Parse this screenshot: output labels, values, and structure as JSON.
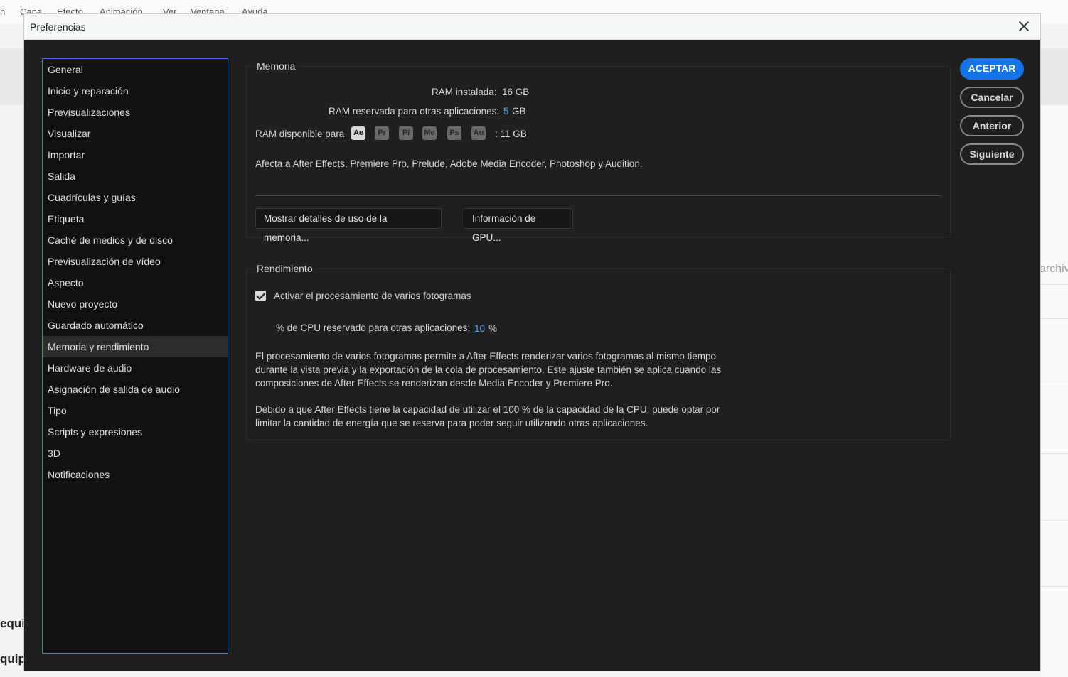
{
  "menubar": {
    "items": [
      "n",
      "Capa",
      "Efecto",
      "Animación",
      "Ver",
      "Ventana",
      "Ayuda"
    ]
  },
  "background": {
    "right_text": "archiv",
    "left_text_1": "equi",
    "left_text_2": "quip"
  },
  "dialog": {
    "title": "Preferencias",
    "close_icon": "close-icon"
  },
  "sidebar": {
    "items": [
      "General",
      "Inicio y reparación",
      "Previsualizaciones",
      "Visualizar",
      "Importar",
      "Salida",
      "Cuadrículas y guías",
      "Etiqueta",
      "Caché de medios y de disco",
      "Previsualización de vídeo",
      "Aspecto",
      "Nuevo proyecto",
      "Guardado automático",
      "Memoria y rendimiento",
      "Hardware de audio",
      "Asignación de salida de audio",
      "Tipo",
      "Scripts y expresiones",
      "3D",
      "Notificaciones"
    ],
    "selected": "Memoria y rendimiento"
  },
  "memory": {
    "group_label": "Memoria",
    "ram_installed_label": "RAM instalada:",
    "ram_installed_value": "16 GB",
    "ram_reserved_label": "RAM reservada para otras aplicaciones:",
    "ram_reserved_value": "5",
    "ram_reserved_unit": "GB",
    "ram_available_label": "RAM disponible para",
    "apps": [
      "Ae",
      "Pr",
      "Pl",
      "Me",
      "Ps",
      "Au"
    ],
    "ram_available_value": ":  11 GB",
    "affects_text": "Afecta a After Effects, Premiere Pro, Prelude, Adobe Media Encoder, Photoshop y Audition.",
    "memory_details_button": "Mostrar detalles de uso de la memoria...",
    "gpu_info_button": "Información de GPU..."
  },
  "performance": {
    "group_label": "Rendimiento",
    "multiframe_checkbox_label": "Activar el procesamiento de varios fotogramas",
    "multiframe_checked": true,
    "cpu_reserved_label": "% de CPU reservado para otras aplicaciones:",
    "cpu_reserved_value": "10",
    "cpu_reserved_unit": "%",
    "description_1": "El procesamiento de varios fotogramas permite a After Effects renderizar varios fotogramas al mismo tiempo durante la vista previa y la exportación de la cola de procesamiento. Este ajuste también se aplica cuando las composiciones de After Effects se renderizan desde Media Encoder y Premiere Pro.",
    "description_2": "Debido a que After Effects tiene la capacidad de utilizar el 100 % de la capacidad de la CPU, puede optar por limitar la cantidad de energía que se reserva para poder seguir utilizando otras aplicaciones."
  },
  "buttons": {
    "accept": "ACEPTAR",
    "cancel": "Cancelar",
    "previous": "Anterior",
    "next": "Siguiente"
  },
  "colors": {
    "accent": "#1473e6",
    "value_blue": "#5ea3f2",
    "dialog_bg": "#1f1f1f",
    "sidebar_border": "#3c7de0"
  }
}
